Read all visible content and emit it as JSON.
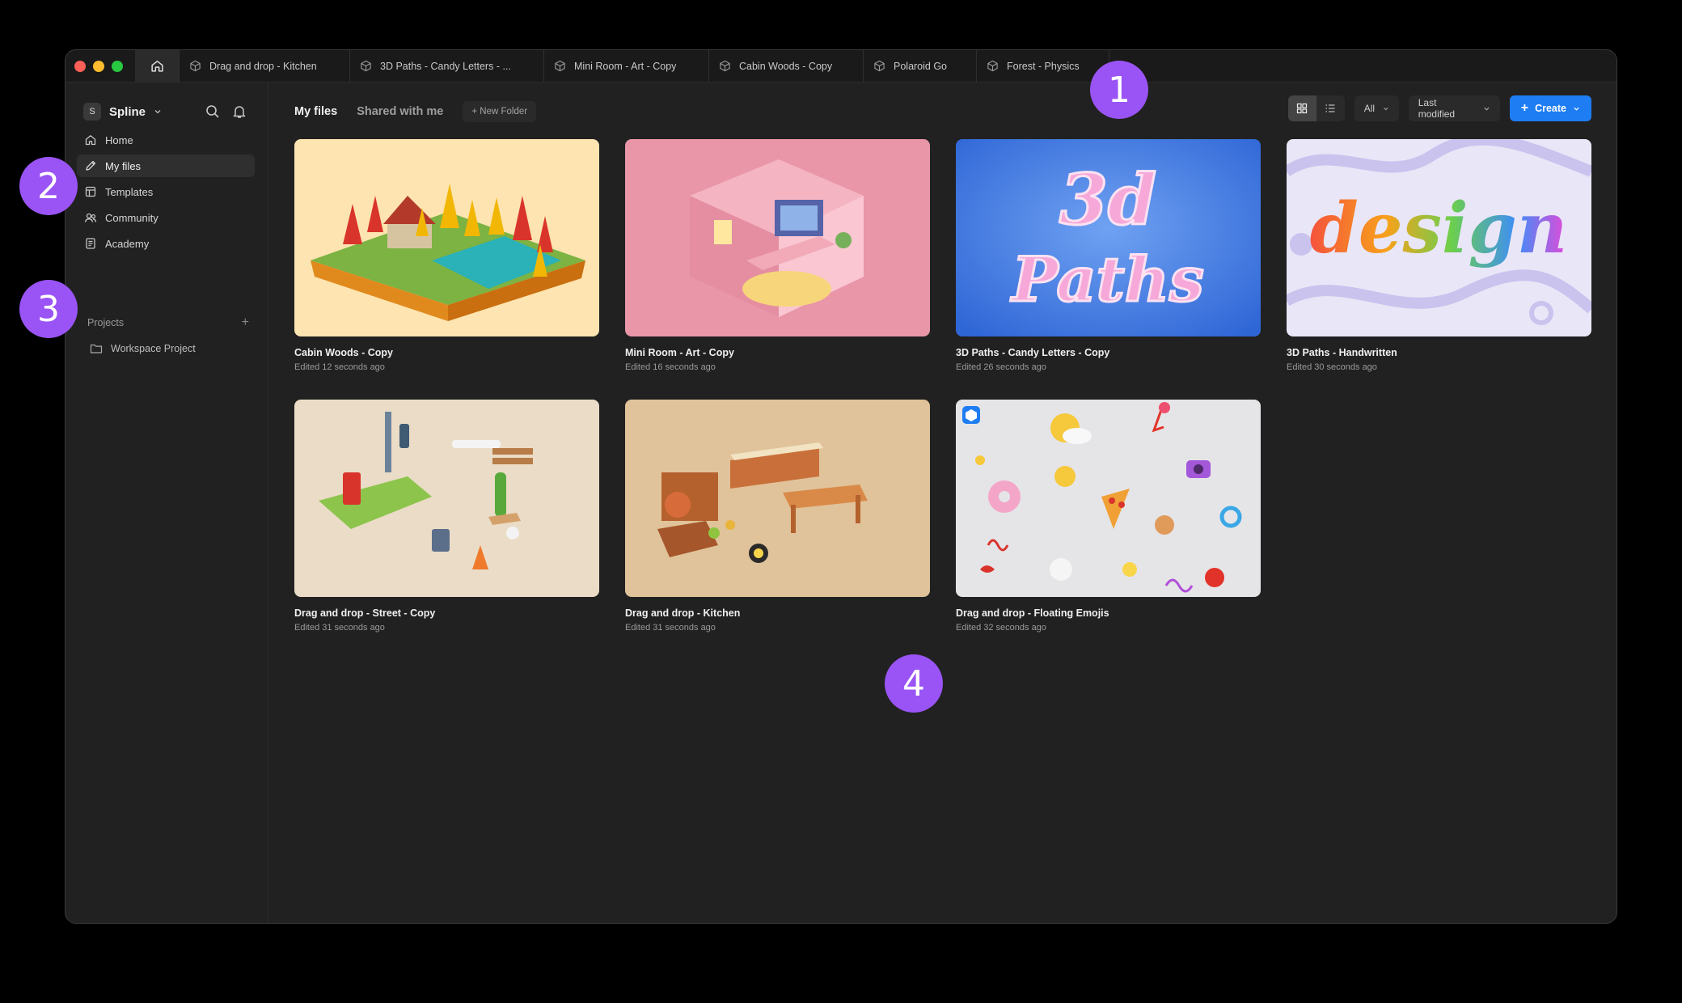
{
  "tabs": [
    {
      "label": "Drag and drop - Kitchen"
    },
    {
      "label": "3D Paths - Candy Letters - ..."
    },
    {
      "label": "Mini Room - Art - Copy"
    },
    {
      "label": "Cabin Woods - Copy"
    },
    {
      "label": "Polaroid Go"
    },
    {
      "label": "Forest - Physics"
    }
  ],
  "workspace": {
    "initial": "S",
    "name": "Spline"
  },
  "nav": [
    {
      "label": "Home",
      "icon": "home-icon"
    },
    {
      "label": "My files",
      "icon": "pencil-icon",
      "active": true
    },
    {
      "label": "Templates",
      "icon": "templates-icon"
    },
    {
      "label": "Community",
      "icon": "community-icon"
    },
    {
      "label": "Academy",
      "icon": "academy-icon"
    }
  ],
  "projects": {
    "heading": "Projects",
    "add": "+",
    "items": [
      {
        "label": "Workspace Project"
      }
    ]
  },
  "topbar": {
    "my_files": "My files",
    "shared": "Shared with me",
    "new_folder": "+ New Folder"
  },
  "controls": {
    "filter": "All",
    "sort": "Last modified",
    "create": "Create"
  },
  "files": [
    {
      "title": "Cabin Woods - Copy",
      "edited": "Edited 12 seconds ago",
      "bg": "#fde4b0"
    },
    {
      "title": "Mini Room - Art - Copy",
      "edited": "Edited 16 seconds ago",
      "bg": "#e996a9"
    },
    {
      "title": "3D Paths - Candy Letters - Copy",
      "edited": "Edited 26 seconds ago",
      "bg": "#3f7de6"
    },
    {
      "title": "3D Paths - Handwritten",
      "edited": "Edited 30 seconds ago",
      "bg": "#e9e6f7"
    },
    {
      "title": "Drag and drop - Street - Copy",
      "edited": "Edited 31 seconds ago",
      "bg": "#eadcc6"
    },
    {
      "title": "Drag and drop - Kitchen",
      "edited": "Edited 31 seconds ago",
      "bg": "#e0c39a"
    },
    {
      "title": "Drag and drop - Floating Emojis",
      "edited": "Edited 32 seconds ago",
      "bg": "#e5e5e8"
    }
  ],
  "thumb_text": {
    "candy_line1": "3d",
    "candy_line2": "Paths",
    "handwritten": "design"
  },
  "callouts": [
    "1",
    "2",
    "3",
    "4"
  ],
  "colors": {
    "accent": "#1e7df2",
    "callout": "#9a54f5"
  }
}
